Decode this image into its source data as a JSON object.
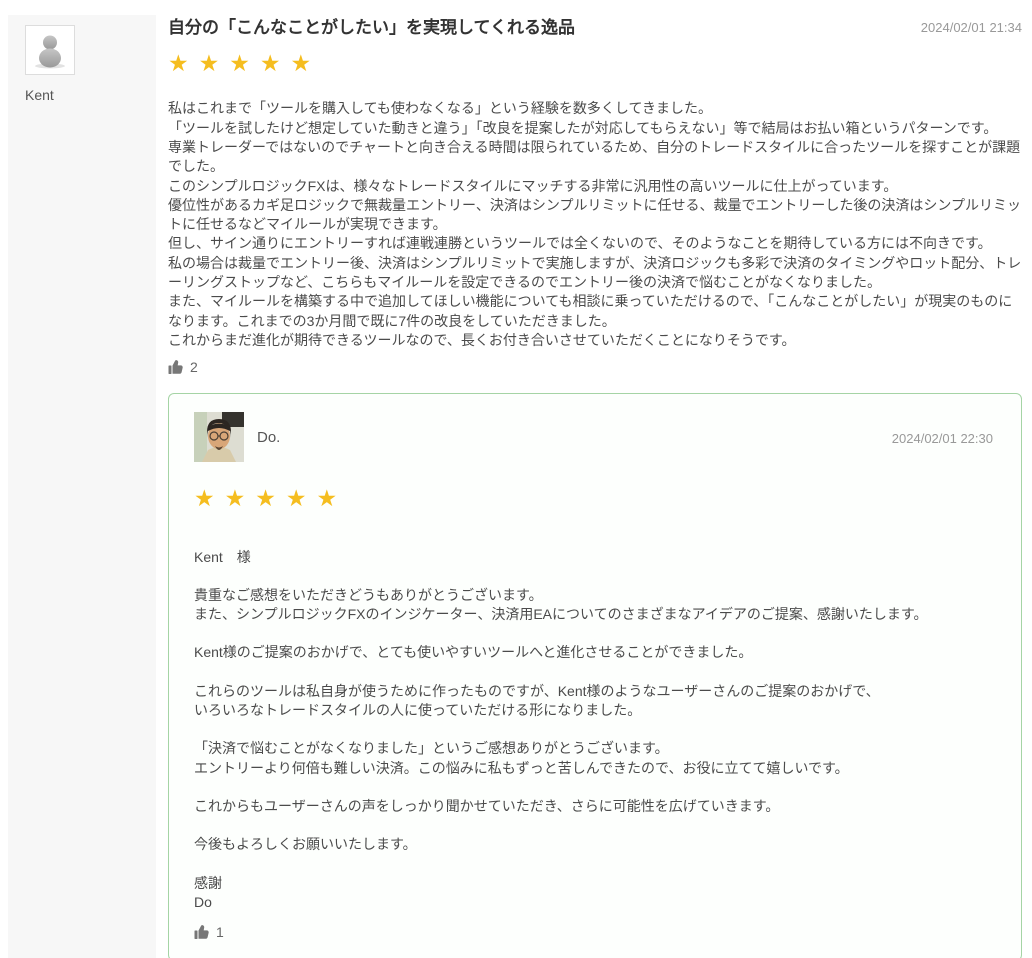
{
  "colors": {
    "star": "#F5BD1F",
    "reply_border": "#A5D4A5",
    "timestamp_text": "#999999",
    "like_icon": "#777777",
    "sidebar_bg": "#F7F7F7"
  },
  "review": {
    "author": "Kent",
    "avatar_icon": "person-silhouette-icon",
    "title": "自分の「こんなことがしたい」を実現してくれる逸品",
    "timestamp": "2024/02/01 21:34",
    "rating_value": 5,
    "rating_stars": "★★★★★",
    "body_lines": [
      "私はこれまで「ツールを購入しても使わなくなる」という経験を数多くしてきました。",
      "「ツールを試したけど想定していた動きと違う」「改良を提案したが対応してもらえない」等で結局はお払い箱というパターンです。",
      "専業トレーダーではないのでチャートと向き合える時間は限られているため、自分のトレードスタイルに合ったツールを探すことが課題でした。",
      "このシンプルロジックFXは、様々なトレードスタイルにマッチする非常に汎用性の高いツールに仕上がっています。",
      "優位性があるカギ足ロジックで無裁量エントリー、決済はシンプルリミットに任せる、裁量でエントリーした後の決済はシンプルリミットに任せるなどマイルールが実現できます。",
      "但し、サイン通りにエントリーすれば連戦連勝というツールでは全くないので、そのようなことを期待している方には不向きです。",
      "私の場合は裁量でエントリー後、決済はシンプルリミットで実施しますが、決済ロジックも多彩で決済のタイミングやロット配分、トレーリングストップなど、こちらもマイルールを設定できるのでエントリー後の決済で悩むことがなくなりました。",
      "また、マイルールを構築する中で追加してほしい機能についても相談に乗っていただけるので、「こんなことがしたい」が現実のものになります。これまでの3か月間で既に7件の改良をしていただきました。",
      "これからまだ進化が期待できるツールなので、長くお付き合いさせていただくことになりそうです。"
    ],
    "like_count": "2"
  },
  "reply": {
    "author": "Do.",
    "timestamp": "2024/02/01 22:30",
    "rating_value": 5,
    "rating_stars": "★★★★★",
    "paragraphs": [
      "Kent　様",
      "貴重なご感想をいただきどうもありがとうございます。\nまた、シンプルロジックFXのインジケーター、決済用EAについてのさまざまなアイデアのご提案、感謝いたします。",
      "Kent様のご提案のおかげで、とても使いやすいツールへと進化させることができました。",
      "これらのツールは私自身が使うために作ったものですが、Kent様のようなユーザーさんのご提案のおかげで、\nいろいろなトレードスタイルの人に使っていただける形になりました。",
      "「決済で悩むことがなくなりました」というご感想ありがとうございます。\nエントリーより何倍も難しい決済。この悩みに私もずっと苦しんできたので、お役に立てて嬉しいです。",
      "これからもユーザーさんの声をしっかり聞かせていただき、さらに可能性を広げていきます。",
      "今後もよろしくお願いいたします。",
      "感謝\nDo"
    ],
    "like_count": "1"
  }
}
